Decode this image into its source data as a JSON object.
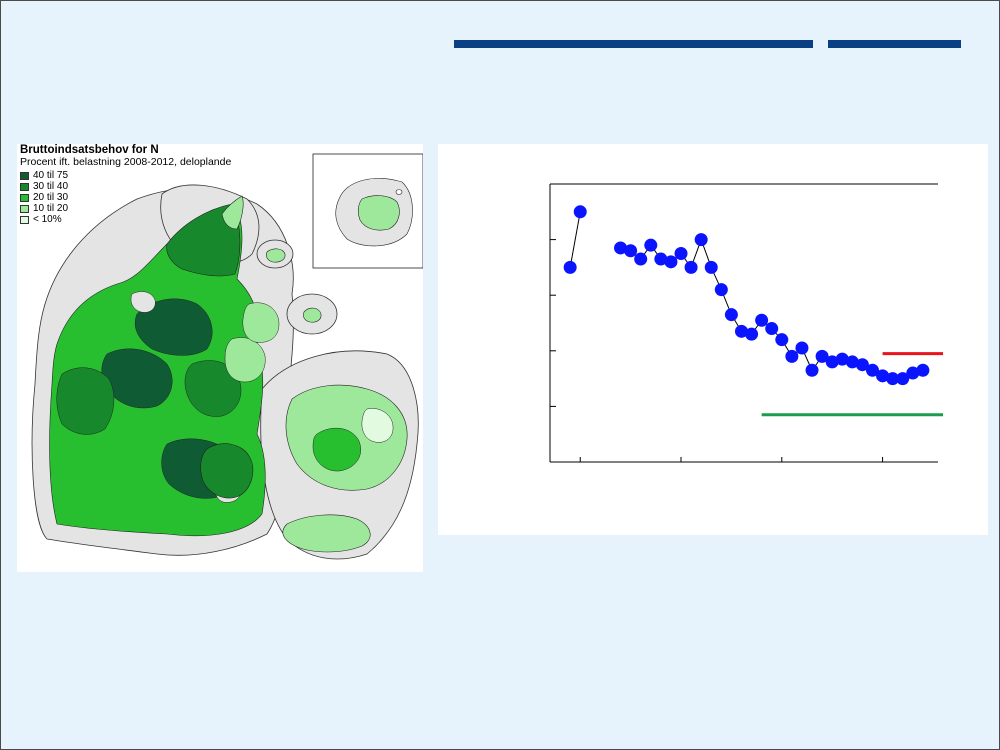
{
  "slide": {
    "accent_color": "#0b3f84",
    "background_color": "#e6f3fd"
  },
  "map": {
    "title": "Bruttoindsatsbehov for N",
    "subtitle": "Procent ift. belastning 2008-2012, deloplande",
    "legend": [
      {
        "label": "40 til 75",
        "color": "#0f5b34"
      },
      {
        "label": "30 til 40",
        "color": "#17892c"
      },
      {
        "label": "20 til 30",
        "color": "#27bf30"
      },
      {
        "label": "10 til 20",
        "color": "#9ee89b"
      },
      {
        "label": "< 10%",
        "color": "#e2fbe0"
      }
    ]
  },
  "chart_data": {
    "type": "scatter",
    "title": "",
    "xlabel": "",
    "ylabel": "",
    "grid": false,
    "series": [
      {
        "color": "#0a14ff",
        "marker": "circle",
        "points": [
          [
            0,
            0.7
          ],
          [
            1,
            0.9
          ],
          [
            5,
            0.77
          ],
          [
            6,
            0.76
          ],
          [
            7,
            0.73
          ],
          [
            8,
            0.78
          ],
          [
            9,
            0.73
          ],
          [
            10,
            0.72
          ],
          [
            11,
            0.75
          ],
          [
            12,
            0.7
          ],
          [
            13,
            0.8
          ],
          [
            14,
            0.7
          ],
          [
            15,
            0.62
          ],
          [
            16,
            0.53
          ],
          [
            17,
            0.47
          ],
          [
            18,
            0.46
          ],
          [
            19,
            0.51
          ],
          [
            20,
            0.48
          ],
          [
            21,
            0.44
          ],
          [
            22,
            0.38
          ],
          [
            23,
            0.41
          ],
          [
            24,
            0.33
          ],
          [
            25,
            0.38
          ],
          [
            26,
            0.36
          ],
          [
            27,
            0.37
          ],
          [
            28,
            0.36
          ],
          [
            29,
            0.35
          ],
          [
            30,
            0.33
          ],
          [
            31,
            0.31
          ],
          [
            32,
            0.3
          ],
          [
            33,
            0.3
          ],
          [
            34,
            0.32
          ],
          [
            35,
            0.33
          ]
        ],
        "connected_segments": [
          [
            0,
            1
          ],
          [
            5,
            35
          ]
        ]
      }
    ],
    "reference_lines": [
      {
        "color": "#e8131b",
        "x_from": 31,
        "x_to": 37,
        "y": 0.39
      },
      {
        "color": "#1a9d4d",
        "x_from": 19,
        "x_to": 37,
        "y": 0.17
      }
    ],
    "xlim": [
      -2,
      36.5
    ],
    "ylim": [
      0,
      1.0
    ],
    "yticks": [
      0.2,
      0.4,
      0.6,
      0.8,
      1.0
    ],
    "xticks": [
      1,
      11,
      21,
      31
    ]
  }
}
